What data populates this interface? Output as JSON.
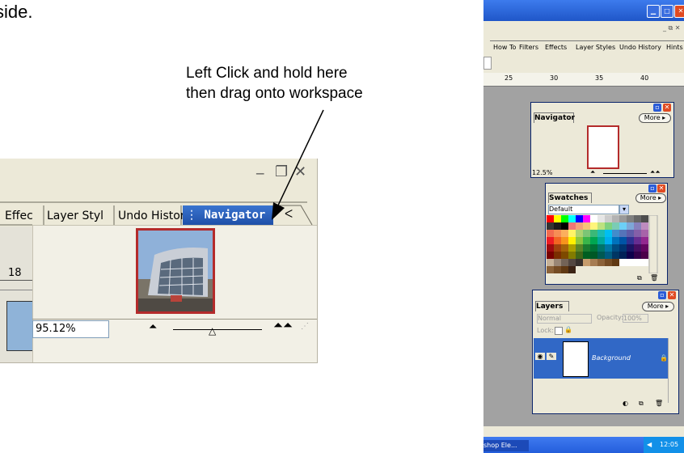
{
  "page_text": "side.",
  "callout": {
    "line1": "Left Click and hold here",
    "line2": "then drag onto workspace"
  },
  "zoom_panel": {
    "tabs": [
      "Effec",
      "Layer Styl",
      "Undo Histor"
    ],
    "navigator_tab": "Navigator",
    "ruler_number": "18",
    "zoom_value": "95.12%"
  },
  "app": {
    "tabs": [
      "How To",
      "Filters",
      "Effects",
      "Layer Styles",
      "Undo History",
      "Hints"
    ],
    "ruler_numbers": [
      "25",
      "30",
      "35",
      "40"
    ],
    "navigator": {
      "title": "Navigator",
      "more": "More",
      "zoom": "12.5%"
    },
    "swatches": {
      "title": "Swatches",
      "more": "More",
      "preset": "Default"
    },
    "layers": {
      "title": "Layers",
      "more": "More",
      "blend": "Normal",
      "opacity_label": "Opacity:",
      "opacity_value": "100%",
      "lock_label": "Lock:",
      "layer_name": "Background"
    },
    "taskbar": {
      "app_label": "shop Ele...",
      "clock": "12:05"
    }
  },
  "colors": {
    "xp_blue": "#2a5bd7",
    "xp_close": "#e04a22",
    "selection_blue": "#3168c6",
    "thumb_frame": "#b42b2b"
  }
}
